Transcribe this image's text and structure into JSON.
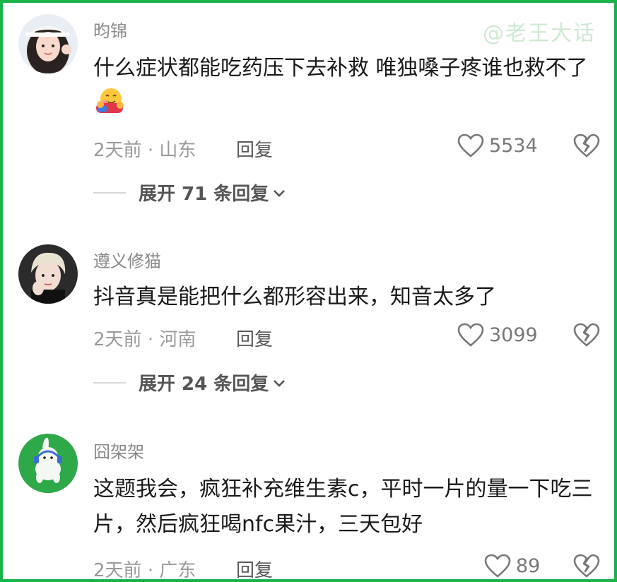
{
  "watermark": "@老王大话",
  "comments": [
    {
      "username": "昀锦",
      "text": "什么症状都能吃药压下去补救 唯独嗓子疼谁也救不了",
      "emoji": "hugging-face-emoji",
      "time": "2天前",
      "location": "山东",
      "reply_label": "回复",
      "likes": "5534",
      "expand_label": "展开 71 条回复"
    },
    {
      "username": "遵义修猫",
      "text": "抖音真是能把什么都形容出来，知音太多了",
      "time": "2天前",
      "location": "河南",
      "reply_label": "回复",
      "likes": "3099",
      "expand_label": "展开 24 条回复"
    },
    {
      "username": "囧架架",
      "text": "这题我会，疯狂补充维生素c，平时一片的量一下吃三片，然后疯狂喝nfc果汁，三天包好",
      "time": "2天前",
      "location": "广东",
      "reply_label": "回复",
      "likes": "89"
    }
  ],
  "colors": {
    "border": "#19b34a",
    "username": "#8a8a8a",
    "text": "#1a1a1a",
    "meta": "#9a9a9a"
  }
}
